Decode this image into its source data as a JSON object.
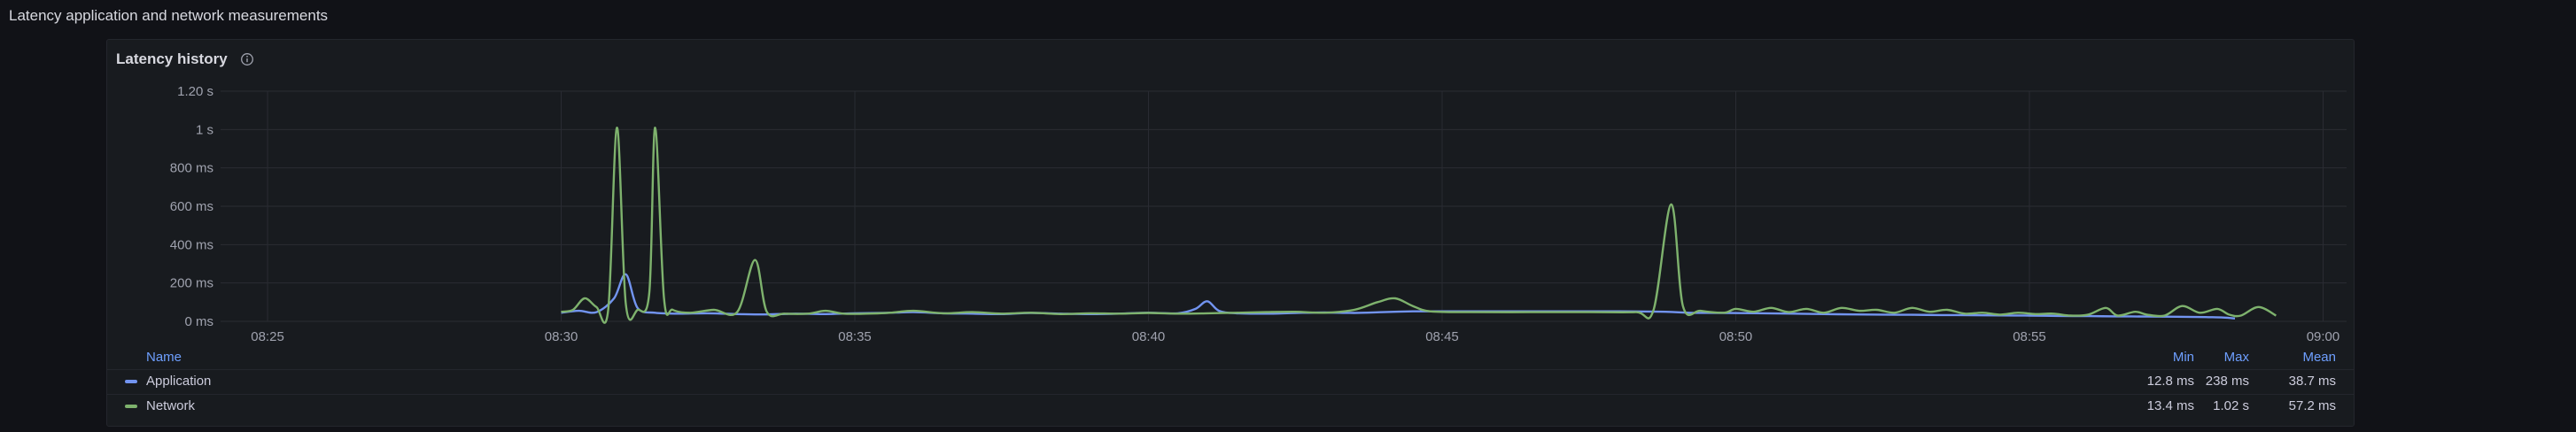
{
  "row": {
    "title": "Latency application and network measurements"
  },
  "panel": {
    "title": "Latency history",
    "info_icon": "info-circle-icon"
  },
  "colors": {
    "application": "#7294f0",
    "network": "#7eb26d",
    "grid": "#2a2c33",
    "background": "#181b1f"
  },
  "chart_data": {
    "type": "line",
    "title": "Latency history",
    "y_ticks": [
      "1.20 s",
      "1 s",
      "800 ms",
      "600 ms",
      "400 ms",
      "200 ms",
      "0 ms"
    ],
    "y_tick_values_ms": [
      1200,
      1000,
      800,
      600,
      400,
      200,
      0
    ],
    "x_ticks": [
      "08:25",
      "08:30",
      "08:35",
      "08:40",
      "08:45",
      "08:50",
      "08:55",
      "09:00"
    ],
    "x_unit": "minutes past 08:00",
    "x_tick_values": [
      25,
      30,
      35,
      40,
      45,
      50,
      55,
      60
    ],
    "xlim": [
      24.2,
      60.4
    ],
    "ylim_ms": [
      0,
      1200
    ],
    "series": [
      {
        "name": "Application",
        "color": "#7294f0",
        "points": [
          [
            30.0,
            45
          ],
          [
            30.3,
            55
          ],
          [
            30.6,
            48
          ],
          [
            30.9,
            120
          ],
          [
            31.1,
            245
          ],
          [
            31.3,
            70
          ],
          [
            31.6,
            45
          ],
          [
            32.0,
            40
          ],
          [
            32.5,
            42
          ],
          [
            33.0,
            38
          ],
          [
            33.5,
            36
          ],
          [
            34.0,
            40
          ],
          [
            34.5,
            38
          ],
          [
            35.0,
            42
          ],
          [
            35.5,
            44
          ],
          [
            36.0,
            48
          ],
          [
            36.5,
            42
          ],
          [
            37.0,
            40
          ],
          [
            37.5,
            38
          ],
          [
            38.0,
            44
          ],
          [
            38.5,
            40
          ],
          [
            39.0,
            38
          ],
          [
            39.5,
            40
          ],
          [
            40.0,
            45
          ],
          [
            40.5,
            42
          ],
          [
            40.8,
            65
          ],
          [
            41.0,
            105
          ],
          [
            41.2,
            55
          ],
          [
            41.5,
            42
          ],
          [
            42.0,
            40
          ],
          [
            42.5,
            44
          ],
          [
            43.0,
            46
          ],
          [
            43.5,
            44
          ],
          [
            44.0,
            48
          ],
          [
            44.5,
            52
          ],
          [
            45.0,
            52
          ],
          [
            46.0,
            52
          ],
          [
            47.0,
            52
          ],
          [
            48.0,
            52
          ],
          [
            48.8,
            50
          ],
          [
            49.2,
            45
          ],
          [
            49.8,
            44
          ],
          [
            50.5,
            42
          ],
          [
            51.0,
            40
          ],
          [
            51.5,
            38
          ],
          [
            52.0,
            36
          ],
          [
            52.5,
            35
          ],
          [
            53.0,
            34
          ],
          [
            53.5,
            33
          ],
          [
            54.0,
            32
          ],
          [
            54.5,
            31
          ],
          [
            55.0,
            30
          ],
          [
            55.5,
            28
          ],
          [
            56.0,
            27
          ],
          [
            56.5,
            26
          ],
          [
            57.0,
            25
          ],
          [
            57.5,
            24
          ],
          [
            58.0,
            22
          ],
          [
            58.3,
            20
          ],
          [
            58.5,
            15
          ]
        ]
      },
      {
        "name": "Network",
        "color": "#7eb26d",
        "points": [
          [
            30.0,
            50
          ],
          [
            30.2,
            60
          ],
          [
            30.4,
            120
          ],
          [
            30.6,
            75
          ],
          [
            30.8,
            60
          ],
          [
            30.95,
            1010
          ],
          [
            31.1,
            90
          ],
          [
            31.3,
            60
          ],
          [
            31.5,
            150
          ],
          [
            31.6,
            1010
          ],
          [
            31.75,
            120
          ],
          [
            31.9,
            60
          ],
          [
            32.2,
            45
          ],
          [
            32.6,
            60
          ],
          [
            33.0,
            50
          ],
          [
            33.3,
            320
          ],
          [
            33.5,
            50
          ],
          [
            33.8,
            40
          ],
          [
            34.2,
            40
          ],
          [
            34.5,
            55
          ],
          [
            34.8,
            40
          ],
          [
            35.2,
            40
          ],
          [
            35.6,
            45
          ],
          [
            36.0,
            55
          ],
          [
            36.5,
            42
          ],
          [
            37.0,
            48
          ],
          [
            37.5,
            40
          ],
          [
            38.0,
            45
          ],
          [
            38.5,
            38
          ],
          [
            39.0,
            42
          ],
          [
            39.5,
            40
          ],
          [
            40.0,
            44
          ],
          [
            40.5,
            40
          ],
          [
            41.0,
            42
          ],
          [
            41.5,
            45
          ],
          [
            42.0,
            48
          ],
          [
            42.5,
            50
          ],
          [
            43.0,
            45
          ],
          [
            43.5,
            60
          ],
          [
            43.9,
            100
          ],
          [
            44.2,
            120
          ],
          [
            44.5,
            80
          ],
          [
            44.8,
            52
          ],
          [
            45.5,
            48
          ],
          [
            46.5,
            48
          ],
          [
            47.5,
            48
          ],
          [
            48.3,
            48
          ],
          [
            48.6,
            60
          ],
          [
            48.9,
            610
          ],
          [
            49.1,
            80
          ],
          [
            49.4,
            55
          ],
          [
            49.8,
            45
          ],
          [
            50.0,
            65
          ],
          [
            50.3,
            50
          ],
          [
            50.6,
            70
          ],
          [
            50.9,
            48
          ],
          [
            51.2,
            65
          ],
          [
            51.5,
            45
          ],
          [
            51.8,
            70
          ],
          [
            52.1,
            55
          ],
          [
            52.4,
            60
          ],
          [
            52.7,
            45
          ],
          [
            53.0,
            70
          ],
          [
            53.3,
            50
          ],
          [
            53.6,
            60
          ],
          [
            53.9,
            40
          ],
          [
            54.2,
            45
          ],
          [
            54.5,
            35
          ],
          [
            54.8,
            45
          ],
          [
            55.1,
            38
          ],
          [
            55.4,
            40
          ],
          [
            55.7,
            30
          ],
          [
            56.0,
            35
          ],
          [
            56.3,
            70
          ],
          [
            56.5,
            30
          ],
          [
            56.8,
            50
          ],
          [
            57.0,
            35
          ],
          [
            57.3,
            30
          ],
          [
            57.6,
            80
          ],
          [
            57.9,
            45
          ],
          [
            58.2,
            65
          ],
          [
            58.4,
            35
          ],
          [
            58.6,
            30
          ],
          [
            58.9,
            75
          ],
          [
            59.2,
            30
          ]
        ]
      }
    ]
  },
  "legend": {
    "headers": {
      "name": "Name",
      "min": "Min",
      "max": "Max",
      "mean": "Mean"
    },
    "rows": [
      {
        "name": "Application",
        "min": "12.8 ms",
        "max": "238 ms",
        "mean": "38.7 ms",
        "color": "#7294f0"
      },
      {
        "name": "Network",
        "min": "13.4 ms",
        "max": "1.02 s",
        "mean": "57.2 ms",
        "color": "#7eb26d"
      }
    ]
  }
}
